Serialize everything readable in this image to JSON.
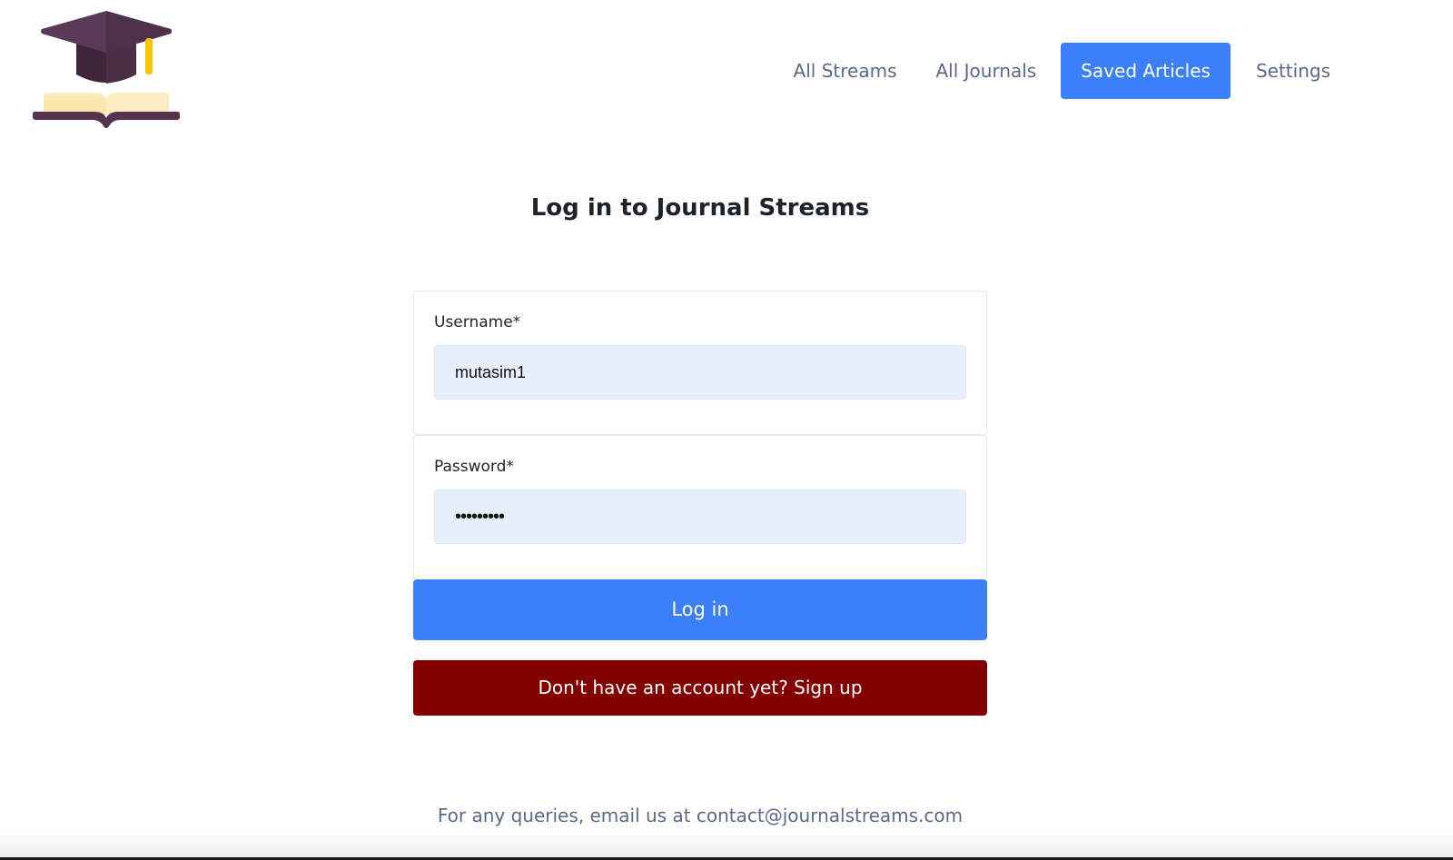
{
  "header": {
    "logo_icon": "graduation-cap-book-icon",
    "nav": [
      {
        "label": "All Streams",
        "active": false
      },
      {
        "label": "All Journals",
        "active": false
      },
      {
        "label": "Saved Articles",
        "active": true
      },
      {
        "label": "Settings",
        "active": false
      }
    ]
  },
  "main": {
    "title": "Log in to Journal Streams",
    "username": {
      "label": "Username*",
      "value": "mutasim1"
    },
    "password": {
      "label": "Password*",
      "value": "•••••••••"
    },
    "login_label": "Log in",
    "signup_label": "Don't have an account yet? Sign up"
  },
  "footer": {
    "text": "For any queries, email us at contact@journalstreams.com"
  },
  "colors": {
    "accent": "#3b7ffa",
    "signup": "#820000",
    "input_bg": "#e8effc",
    "muted_text": "#5b6a82"
  }
}
